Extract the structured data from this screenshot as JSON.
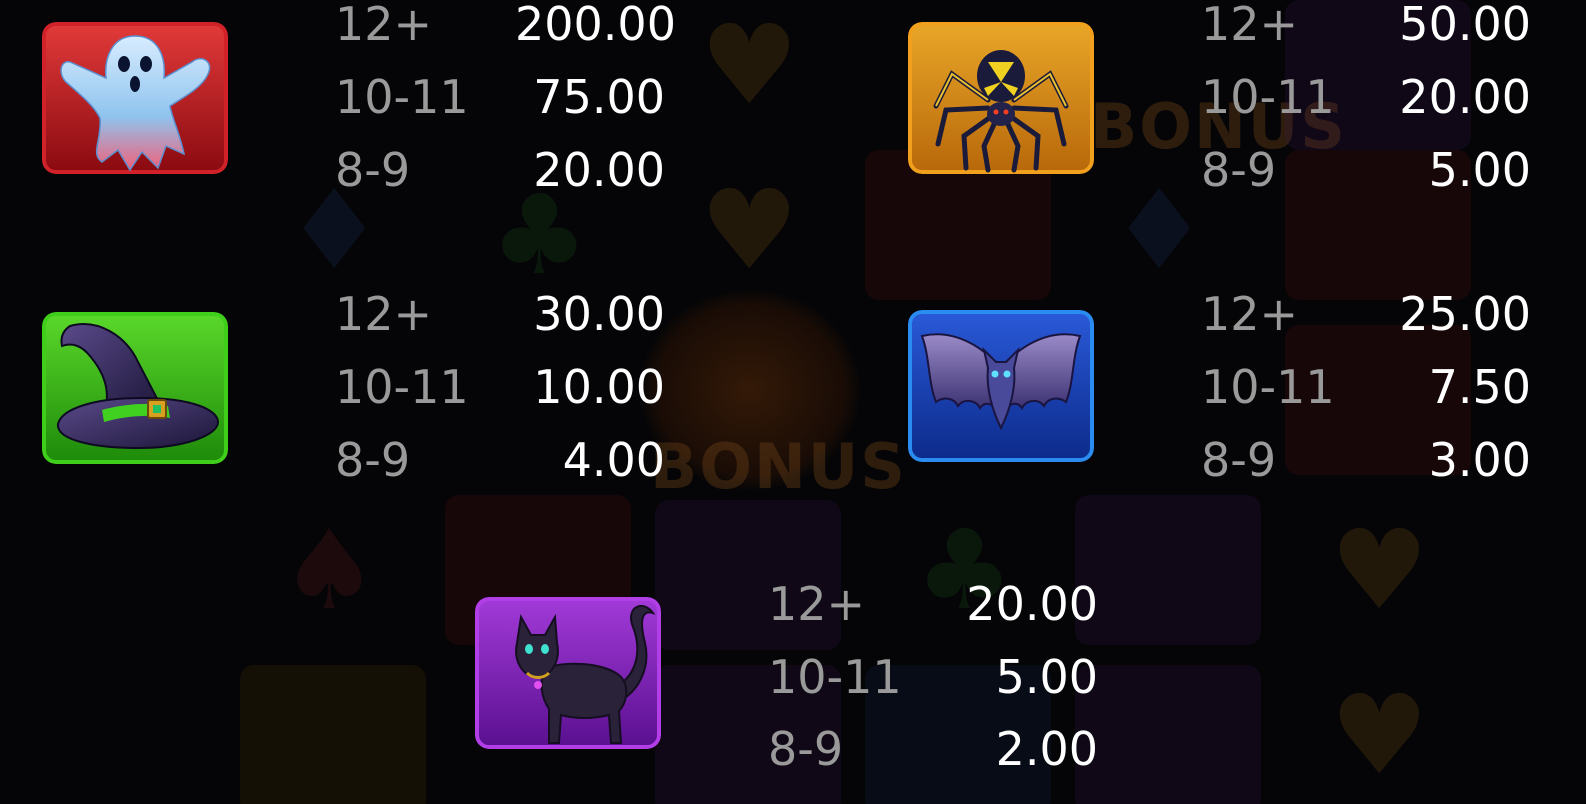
{
  "paytable": {
    "symbols": [
      {
        "name": "ghost",
        "icon": "ghost-icon",
        "frame_color": "#d1222a",
        "pays": [
          {
            "count": "12+",
            "value": "200.00"
          },
          {
            "count": "10-11",
            "value": "75.00"
          },
          {
            "count": "8-9",
            "value": "20.00"
          }
        ]
      },
      {
        "name": "spider",
        "icon": "spider-icon",
        "frame_color": "#f0a01c",
        "pays": [
          {
            "count": "12+",
            "value": "50.00"
          },
          {
            "count": "10-11",
            "value": "20.00"
          },
          {
            "count": "8-9",
            "value": "5.00"
          }
        ]
      },
      {
        "name": "witch-hat",
        "icon": "witch-hat-icon",
        "frame_color": "#3fcf1a",
        "pays": [
          {
            "count": "12+",
            "value": "30.00"
          },
          {
            "count": "10-11",
            "value": "10.00"
          },
          {
            "count": "8-9",
            "value": "4.00"
          }
        ]
      },
      {
        "name": "bat",
        "icon": "bat-icon",
        "frame_color": "#2a8cf0",
        "pays": [
          {
            "count": "12+",
            "value": "25.00"
          },
          {
            "count": "10-11",
            "value": "7.50"
          },
          {
            "count": "8-9",
            "value": "3.00"
          }
        ]
      },
      {
        "name": "black-cat",
        "icon": "cat-icon",
        "frame_color": "#b23ee8",
        "pays": [
          {
            "count": "12+",
            "value": "20.00"
          },
          {
            "count": "10-11",
            "value": "5.00"
          },
          {
            "count": "8-9",
            "value": "2.00"
          }
        ]
      }
    ]
  },
  "background": {
    "bonus_text": "BONUS"
  }
}
